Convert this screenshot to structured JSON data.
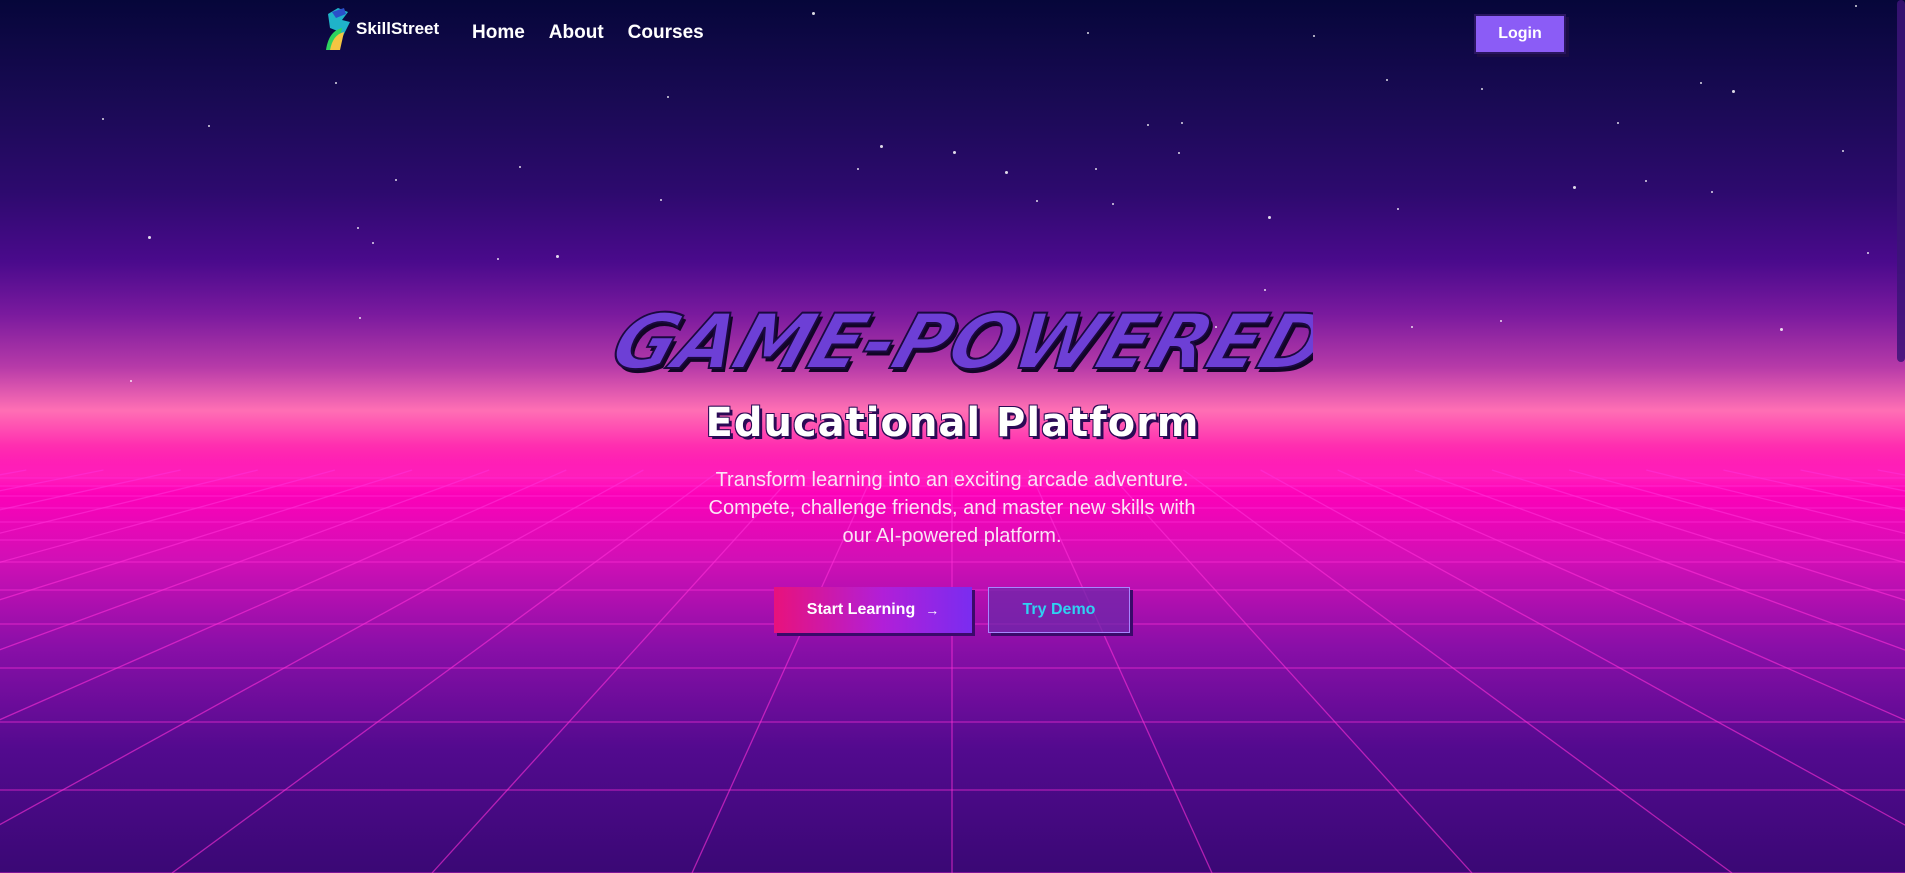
{
  "brand": {
    "name": "SkillStreet",
    "logo_icon": "skillstreet-logo-icon"
  },
  "nav": {
    "links": [
      "Home",
      "About",
      "Courses"
    ],
    "login_label": "Login"
  },
  "hero": {
    "headline": "GAME-POWERED",
    "subtitle": "Educational Platform",
    "description": "Transform learning into an exciting arcade adventure. Compete, challenge friends, and master new skills with our AI-powered platform.",
    "primary_button": "Start Learning",
    "primary_button_icon": "arrow-right-icon",
    "secondary_button": "Try Demo"
  },
  "colors": {
    "accent": "#8b5cf6",
    "headline": "#6d3fd6",
    "demo_text": "#2fd1f2",
    "grid": "#ff2fd8"
  }
}
